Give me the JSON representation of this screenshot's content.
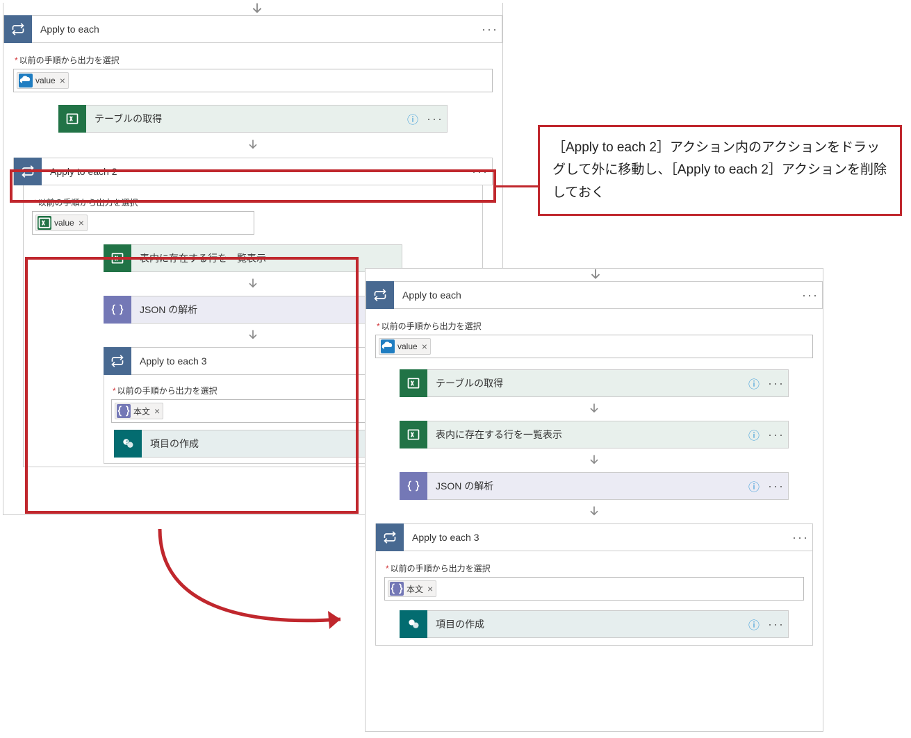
{
  "labels": {
    "selectOutput": "以前の手順から出力を選択"
  },
  "tokens": {
    "value": "value",
    "honbun": "本文"
  },
  "left": {
    "applyEach": "Apply to each",
    "getTables": "テーブルの取得",
    "applyEach2": "Apply to each 2",
    "listRows": "表内に存在する行を一覧表示",
    "parseJson": "JSON の解析",
    "applyEach3": "Apply to each 3",
    "createItem": "項目の作成"
  },
  "right": {
    "applyEach": "Apply to each",
    "getTables": "テーブルの取得",
    "listRows": "表内に存在する行を一覧表示",
    "parseJson": "JSON の解析",
    "applyEach3": "Apply to each 3",
    "createItem": "項目の作成"
  },
  "callout": {
    "text": "［Apply to each 2］アクション内のアクションをドラッグして外に移動し、［Apply to each 2］アクションを削除しておく"
  }
}
